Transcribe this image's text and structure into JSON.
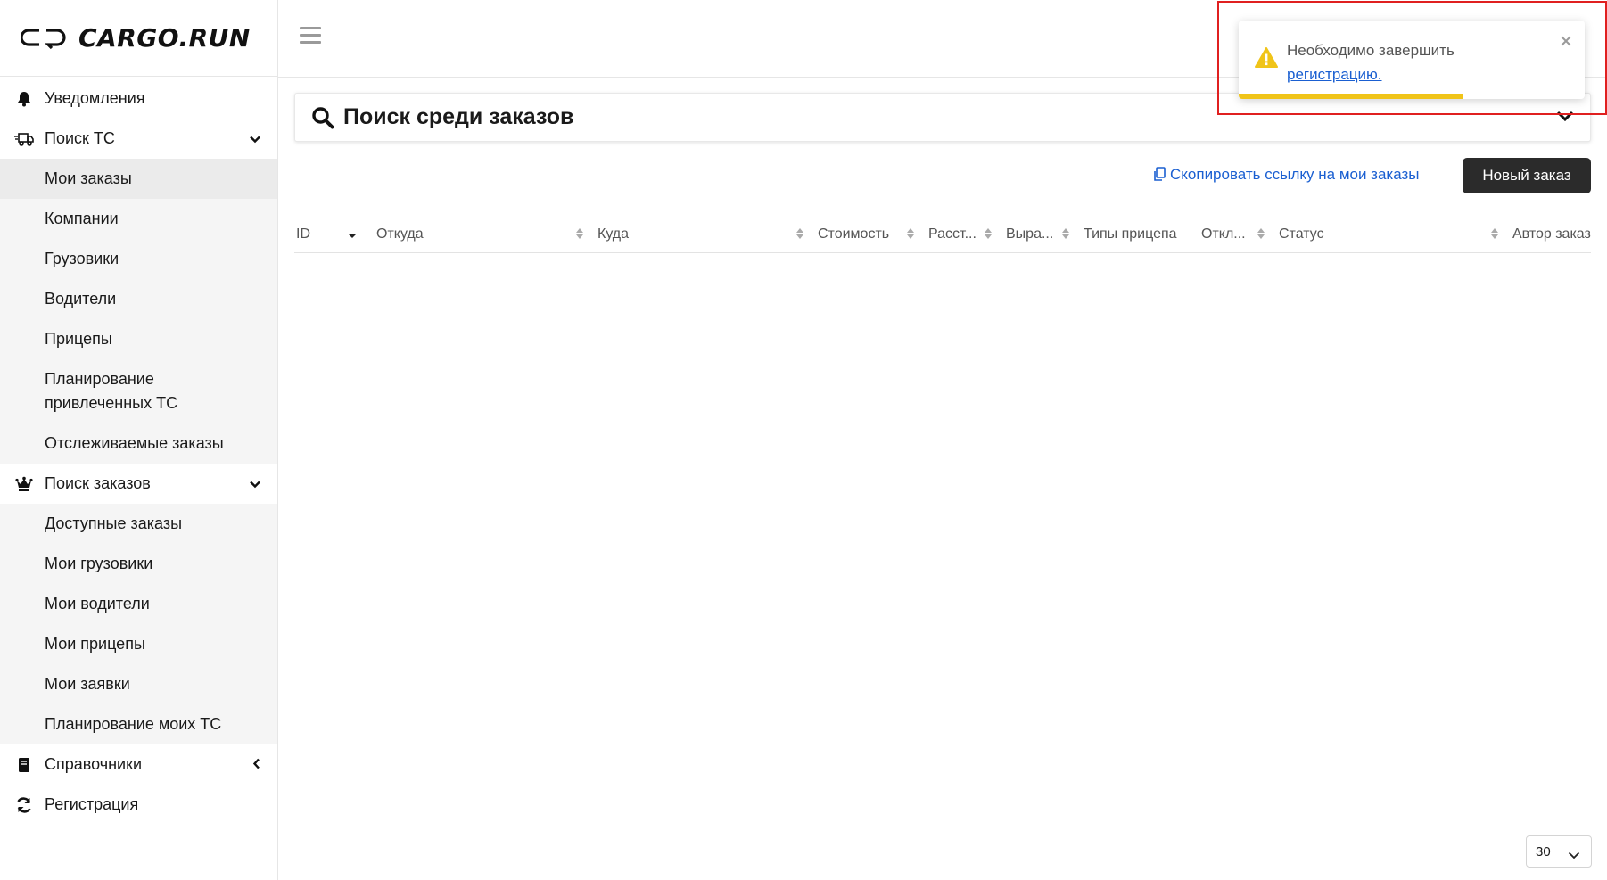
{
  "logo": {
    "text": "CARGO.RUN"
  },
  "sidebar": {
    "items": [
      {
        "label": "Уведомления",
        "icon": "bell-icon"
      },
      {
        "label": "Поиск ТС",
        "icon": "truck-icon",
        "expanded": true,
        "children": [
          "Мои заказы",
          "Компании",
          "Грузовики",
          "Водители",
          "Прицепы",
          "Планирование привлеченных ТС",
          "Отслеживаемые заказы"
        ],
        "active_child": "Мои заказы"
      },
      {
        "label": "Поиск заказов",
        "icon": "crown-icon",
        "expanded": true,
        "children": [
          "Доступные заказы",
          "Мои грузовики",
          "Мои водители",
          "Мои прицепы",
          "Мои заявки",
          "Планирование моих ТС"
        ]
      },
      {
        "label": "Справочники",
        "icon": "book-icon",
        "expanded": false
      },
      {
        "label": "Регистрация",
        "icon": "sync-icon"
      }
    ]
  },
  "search_panel": {
    "title": "Поиск среди заказов"
  },
  "actions": {
    "copy_link_label": "Скопировать ссылку на мои заказы",
    "new_order_label": "Новый заказ"
  },
  "table": {
    "columns": [
      "ID",
      "Откуда",
      "Куда",
      "Стоимость",
      "Расст...",
      "Выра...",
      "Типы прицепа",
      "Откл...",
      "Статус",
      "Автор заказ"
    ],
    "rows": []
  },
  "pagination": {
    "page_size": "30"
  },
  "toast": {
    "message": "Необходимо завершить",
    "link_text": "регистрацию.",
    "type": "warning",
    "progress": 0.65
  },
  "colors": {
    "accent_link": "#1a5fd1",
    "button_dark": "#2b2b2b",
    "warning": "#f0c419",
    "highlight": "#e02020",
    "submenu_bg": "#f5f5f5"
  }
}
